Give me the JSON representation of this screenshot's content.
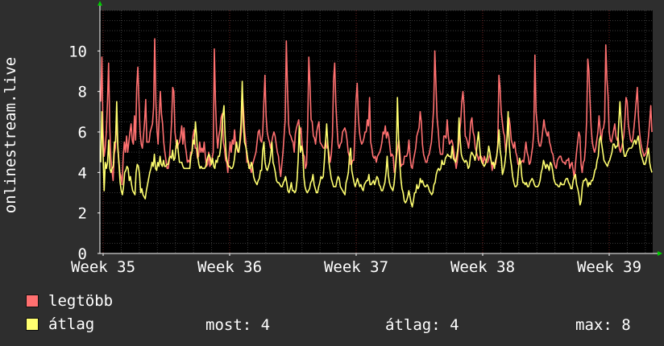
{
  "chart_data": {
    "type": "line",
    "ylabel": "onlinestream.live",
    "ylim": [
      0,
      12
    ],
    "yticks": [
      0,
      2,
      4,
      6,
      8,
      10
    ],
    "xticks": [
      "Week 35",
      "Week 36",
      "Week 37",
      "Week 38",
      "Week 39"
    ],
    "colors": {
      "background": "#2e2e2e",
      "plot": "#000000",
      "grid": "#3c3c3c",
      "week_line": "#6e2222",
      "axis": "#ffffff",
      "arrow": "#00cc00"
    },
    "series": [
      {
        "name": "legtöbb",
        "color": "#ff7070",
        "values": [
          7.5,
          9.7,
          6.2,
          4.8,
          5.2,
          6.0,
          7.5,
          9.4,
          6.3,
          4.7,
          4.1,
          3.6,
          4.9,
          5.2,
          6.6,
          5.5,
          4.7,
          4.0,
          3.8,
          3.4,
          4.8,
          5.5,
          5.0,
          5.8,
          5.0,
          5.5,
          6.0,
          6.4,
          5.6,
          5.4,
          6.8,
          5.6,
          8.2,
          9.2,
          7.5,
          6.0,
          5.4,
          5.2,
          5.8,
          6.5,
          7.6,
          5.5,
          5.5,
          5.5,
          6.0,
          6.2,
          6.4,
          7.2,
          10.6,
          7.5,
          6.1,
          5.4,
          6.8,
          8.0,
          6.9,
          6.4,
          5.5,
          5.0,
          4.6,
          4.2,
          4.2,
          4.6,
          5.5,
          6.5,
          8.2,
          8.0,
          6.0,
          5.5,
          5.2,
          5.4,
          5.5,
          5.8,
          6.3,
          5.4,
          6.2,
          5.4,
          5.0,
          4.5,
          4.6,
          4.5,
          5.0,
          5.0,
          5.8,
          6.1,
          5.2,
          5.2,
          4.7,
          4.8,
          5.5,
          5.0,
          5.2,
          5.0,
          5.5,
          4.8,
          4.3,
          4.4,
          5.0,
          4.3,
          4.4,
          4.7,
          5.0,
          10.1,
          7.5,
          6.0,
          5.2,
          5.8,
          6.1,
          6.7,
          6.9,
          5.5,
          5.2,
          4.6,
          4.5,
          4.0,
          4.8,
          5.5,
          5.0,
          5.6,
          5.4,
          6.1,
          5.3,
          5.2,
          5.0,
          5.1,
          5.5,
          6.0,
          7.9,
          7.0,
          6.0,
          5.5,
          4.5,
          4.6,
          4.4,
          4.2,
          4.0,
          4.4,
          4.6,
          4.8,
          5.0,
          5.5,
          6.0,
          6.1,
          5.6,
          5.5,
          5.9,
          7.4,
          8.8,
          6.8,
          6.0,
          5.7,
          5.5,
          5.2,
          5.5,
          5.8,
          6.0,
          5.8,
          5.4,
          5.0,
          4.8,
          4.2,
          3.8,
          4.4,
          5.0,
          5.8,
          6.6,
          10.5,
          8.2,
          6.4,
          5.9,
          5.8,
          5.6,
          5.5,
          5.0,
          5.9,
          6.2,
          6.4,
          6.6,
          5.9,
          6.2,
          5.4,
          4.9,
          4.8,
          4.2,
          4.4,
          6.3,
          9.7,
          8.4,
          6.6,
          6.5,
          5.8,
          5.7,
          5.4,
          6.0,
          6.3,
          6.5,
          5.5,
          5.4,
          5.3,
          5.2,
          5.2,
          5.6,
          5.2,
          5.3,
          4.9,
          4.5,
          4.9,
          5.8,
          8.6,
          9.4,
          7.4,
          6.3,
          5.4,
          5.2,
          5.4,
          5.5,
          6.0,
          6.1,
          6.2,
          6.0,
          5.6,
          5.0,
          4.8,
          4.4,
          4.4,
          4.6,
          4.6,
          6.0,
          7.6,
          8.4,
          6.8,
          6.0,
          5.6,
          5.4,
          5.5,
          5.7,
          6.0,
          6.0,
          6.6,
          6.3,
          7.7,
          5.5,
          5.2,
          4.8,
          4.7,
          4.8,
          4.5,
          4.8,
          4.9,
          5.0,
          5.2,
          5.5,
          6.0,
          5.9,
          6.3,
          5.7,
          6.0,
          5.8,
          5.3,
          4.8,
          4.9,
          4.8,
          4.0,
          4.2,
          4.8,
          5.2,
          5.6,
          5.0,
          4.3,
          4.4,
          4.4,
          4.8,
          4.8,
          4.8,
          5.0,
          5.6,
          4.8,
          4.3,
          4.2,
          4.6,
          4.9,
          5.2,
          5.8,
          6.0,
          6.2,
          7.0,
          6.5,
          5.4,
          4.9,
          4.7,
          4.5,
          4.5,
          4.8,
          4.9,
          5.2,
          5.5,
          6.3,
          7.2,
          10.0,
          8.4,
          6.7,
          6.1,
          5.3,
          4.9,
          4.9,
          4.9,
          5.8,
          5.8,
          5.7,
          6.6,
          5.8,
          5.4,
          5.5,
          5.6,
          5.4,
          5.0,
          4.6,
          4.2,
          4.6,
          5.2,
          6.0,
          6.5,
          7.5,
          8.0,
          7.3,
          5.8,
          5.7,
          5.5,
          5.2,
          5.7,
          6.5,
          6.7,
          6.0,
          5.8,
          5.2,
          5.0,
          4.8,
          4.6,
          4.8,
          4.8,
          4.7,
          4.4,
          4.8,
          4.6,
          4.5,
          4.5,
          4.7,
          4.9,
          4.6,
          4.1,
          4.5,
          4.4,
          4.4,
          4.8,
          5.4,
          8.8,
          8.2,
          7.0,
          6.5,
          6.0,
          5.8,
          5.0,
          5.5,
          6.0,
          6.7,
          6.3,
          5.6,
          5.4,
          5.2,
          5.5,
          5.0,
          4.8,
          4.4,
          4.4,
          4.5,
          4.5,
          4.6,
          4.5,
          5.0,
          5.5,
          5.0,
          4.8,
          4.4,
          4.5,
          4.9,
          5.3,
          6.0,
          9.8,
          7.0,
          6.4,
          5.6,
          5.3,
          5.3,
          5.6,
          6.1,
          6.6,
          6.2,
          6.0,
          5.8,
          6.0,
          5.5,
          5.3,
          5.0,
          4.9,
          4.5,
          4.3,
          4.2,
          4.6,
          4.7,
          4.8,
          4.8,
          4.6,
          4.5,
          4.5,
          4.4,
          4.6,
          4.6,
          4.7,
          4.2,
          4.4,
          4.5,
          4.1,
          3.7,
          4.4,
          5.0,
          5.5,
          6.0,
          5.8,
          4.4,
          4.0,
          4.5,
          4.6,
          5.3,
          6.6,
          9.6,
          9.0,
          7.5,
          6.2,
          5.5,
          5.2,
          5.0,
          5.2,
          5.6,
          6.0,
          6.8,
          6.1,
          5.5,
          6.1,
          6.2,
          6.6,
          10.3,
          8.6,
          7.8,
          6.0,
          5.6,
          5.5,
          5.8,
          6.1,
          6.4,
          5.8,
          5.6,
          5.7,
          5.2,
          5.0,
          5.2,
          5.5,
          5.8,
          6.6,
          7.7,
          7.5,
          6.4,
          6.0,
          5.6,
          5.5,
          5.7,
          6.2,
          6.8,
          7.5,
          8.2,
          6.8,
          6.0,
          5.5,
          5.2,
          5.0,
          4.8,
          4.9,
          5.0,
          5.3,
          5.8,
          6.5,
          7.3,
          6.0
        ]
      },
      {
        "name": "átlag",
        "color": "#ffff70",
        "values": [
          4.5,
          7.0,
          5.0,
          3.1,
          4.5,
          4.2,
          4.5,
          5.6,
          4.2,
          4.0,
          4.2,
          4.3,
          5.5,
          5.5,
          7.5,
          5.2,
          4.4,
          3.5,
          3.1,
          2.9,
          3.3,
          4.0,
          4.1,
          4.3,
          4.2,
          3.6,
          3.8,
          3.4,
          3.1,
          3.0,
          2.9,
          4.0,
          4.4,
          4.3,
          3.9,
          3.0,
          3.2,
          2.9,
          2.8,
          2.7,
          3.1,
          3.4,
          3.7,
          4.0,
          4.2,
          4.5,
          4.3,
          4.9,
          4.2,
          4.1,
          4.5,
          4.3,
          4.8,
          4.4,
          4.3,
          4.6,
          4.3,
          4.3,
          4.4,
          4.4,
          4.7,
          4.8,
          4.7,
          5.1,
          4.6,
          4.7,
          5.3,
          5.6,
          5.0,
          4.5,
          4.5,
          4.5,
          4.3,
          4.2,
          4.2,
          4.2,
          4.2,
          4.2,
          4.2,
          4.8,
          5.0,
          5.6,
          5.4,
          6.5,
          5.8,
          4.8,
          4.4,
          4.2,
          4.3,
          4.2,
          4.2,
          4.2,
          4.3,
          4.6,
          4.8,
          4.9,
          4.7,
          4.4,
          4.7,
          4.3,
          4.2,
          4.6,
          4.5,
          4.8,
          4.8,
          5.2,
          6.0,
          6.8,
          7.3,
          5.8,
          4.8,
          4.5,
          4.3,
          4.3,
          4.2,
          4.2,
          4.3,
          4.6,
          5.1,
          5.5,
          5.1,
          5.0,
          5.6,
          6.5,
          8.5,
          6.5,
          5.5,
          5.3,
          5.0,
          4.6,
          4.2,
          4.2,
          4.5,
          4.3,
          3.8,
          3.6,
          3.5,
          3.4,
          3.6,
          3.7,
          4.1,
          4.1,
          5.1,
          5.5,
          4.5,
          4.2,
          4.1,
          4.3,
          4.5,
          4.9,
          5.5,
          4.5,
          4.3,
          4.0,
          3.6,
          3.5,
          3.5,
          3.4,
          3.3,
          3.3,
          3.5,
          3.6,
          3.8,
          3.5,
          3.1,
          3.0,
          3.2,
          3.5,
          3.1,
          3.1,
          3.0,
          3.1,
          3.6,
          4.6,
          6.3,
          5.0,
          5.3,
          5.0,
          3.8,
          3.3,
          3.1,
          3.0,
          3.1,
          3.2,
          3.5,
          3.6,
          3.9,
          3.4,
          3.2,
          3.0,
          3.0,
          3.3,
          3.5,
          3.8,
          3.7,
          3.8,
          4.6,
          5.5,
          6.4,
          5.4,
          4.5,
          4.1,
          3.7,
          3.5,
          3.3,
          3.3,
          3.3,
          3.6,
          3.8,
          3.7,
          3.3,
          3.2,
          3.1,
          3.0,
          2.9,
          3.5,
          3.7,
          4.0,
          4.8,
          5.2,
          4.1,
          3.8,
          3.5,
          3.3,
          3.5,
          3.7,
          3.5,
          3.3,
          3.4,
          3.2,
          3.1,
          3.4,
          3.5,
          3.6,
          3.6,
          3.9,
          3.4,
          3.4,
          3.5,
          3.6,
          3.4,
          3.6,
          3.8,
          3.7,
          3.4,
          3.3,
          3.1,
          3.1,
          3.3,
          3.5,
          4.0,
          4.8,
          3.9,
          3.5,
          3.3,
          3.2,
          3.1,
          3.4,
          4.0,
          4.9,
          7.7,
          5.7,
          4.5,
          3.7,
          3.2,
          3.0,
          2.6,
          2.5,
          2.6,
          2.8,
          3.1,
          2.8,
          2.5,
          2.3,
          2.6,
          3.0,
          3.0,
          3.4,
          3.2,
          3.3,
          3.7,
          3.5,
          3.6,
          3.4,
          3.3,
          3.3,
          3.4,
          3.3,
          3.1,
          3.0,
          2.9,
          3.0,
          3.4,
          3.5,
          3.9,
          4.1,
          4.2,
          4.1,
          4.2,
          4.6,
          4.4,
          4.4,
          4.7,
          4.8,
          4.9,
          4.8,
          4.8,
          4.7,
          5.3,
          4.7,
          4.6,
          4.5,
          4.8,
          5.2,
          6.7,
          5.6,
          4.9,
          4.7,
          4.6,
          4.5,
          4.6,
          4.5,
          4.2,
          4.3,
          4.8,
          5.0,
          4.9,
          4.8,
          4.6,
          4.9,
          5.5,
          6.0,
          5.3,
          4.7,
          4.5,
          4.4,
          4.3,
          4.4,
          4.6,
          4.8,
          5.3,
          5.0,
          4.6,
          4.4,
          4.5,
          4.2,
          4.6,
          4.8,
          5.3,
          6.1,
          5.1,
          4.7,
          3.9,
          4.1,
          4.4,
          4.9,
          5.7,
          7.0,
          5.4,
          4.7,
          4.3,
          3.8,
          3.5,
          3.3,
          3.3,
          3.4,
          4.1,
          4.7,
          4.5,
          3.8,
          3.5,
          3.5,
          3.4,
          3.5,
          3.3,
          3.3,
          3.5,
          3.6,
          3.7,
          3.6,
          3.4,
          3.3,
          3.3,
          3.3,
          3.4,
          3.6,
          4.0,
          4.2,
          4.6,
          4.4,
          4.2,
          4.4,
          4.3,
          4.1,
          4.5,
          4.4,
          4.1,
          3.7,
          3.5,
          3.4,
          3.4,
          3.3,
          3.3,
          3.5,
          3.4,
          3.4,
          3.4,
          3.6,
          3.7,
          3.7,
          3.5,
          3.4,
          3.2,
          3.2,
          3.6,
          3.8,
          3.9,
          3.4,
          3.2,
          2.9,
          2.4,
          2.6,
          3.3,
          3.6,
          3.6,
          3.7,
          3.6,
          3.3,
          3.5,
          3.4,
          3.6,
          3.6,
          3.8,
          4.1,
          4.2,
          4.6,
          4.8,
          5.6,
          5.8,
          5.4,
          5.0,
          4.6,
          4.5,
          4.4,
          4.3,
          4.5,
          4.6,
          4.8,
          5.0,
          5.4,
          5.4,
          5.2,
          5.3,
          5.3,
          6.5,
          7.5,
          6.5,
          5.8,
          5.1,
          4.8,
          4.8,
          5.0,
          5.1,
          5.2,
          5.2,
          5.2,
          5.3,
          5.5,
          5.6,
          5.4,
          5.6,
          5.8,
          5.4,
          5.0,
          4.8,
          4.6,
          4.4,
          4.4,
          4.6,
          4.9,
          5.2,
          4.5,
          4.2,
          4.0
        ]
      }
    ],
    "stats": {
      "most_label": "most:",
      "most_value": "4",
      "avg_label": "átlag:",
      "avg_value": "4",
      "max_label": "max:",
      "max_value": "8"
    }
  }
}
